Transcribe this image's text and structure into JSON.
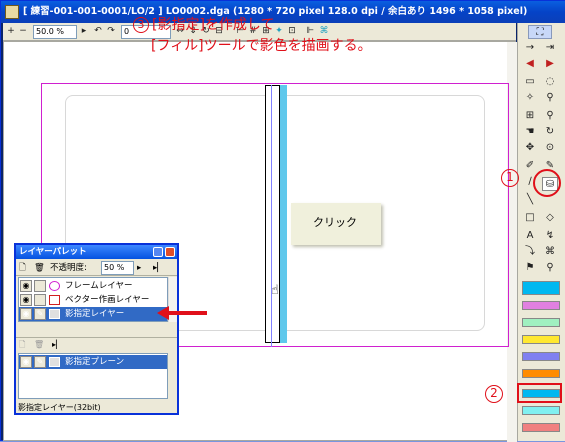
{
  "window": {
    "title": "[ 練習-001-001-0001/LO/2 ] LO0002.dga (1280 * 720 pixel 128.0 dpi / 余白あり 1496 * 1058 pixel)"
  },
  "toolbar": {
    "zoom_value": "50.0 %",
    "angle_value": "0"
  },
  "annotations": {
    "step3_number": "3",
    "step3_line1": "[影指定]を作成して",
    "step3_line2": "[フィル]ツールで影色を描画する。",
    "callout_text": "クリック",
    "step1_number": "1",
    "step2_number": "2"
  },
  "layer_palette": {
    "title": "レイヤーパレット",
    "opacity_label": "不透明度:",
    "opacity_value": "50 %",
    "layers": [
      {
        "name": "フレームレイヤー",
        "selected": false
      },
      {
        "name": "ベクター作画レイヤー",
        "selected": false
      },
      {
        "name": "影指定レイヤー",
        "selected": true
      }
    ],
    "planes": [
      {
        "name": "影指定プレーン",
        "selected": true
      }
    ],
    "status": "影指定レイヤー(32bit)"
  },
  "tool_palette": {
    "colors": [
      "#00b8f0",
      "#e080e0",
      "#a0f0c0",
      "#ffe830",
      "#8080f0",
      "#ff8c00",
      "#00b8f0",
      "#80f0f0",
      "#f08080"
    ]
  }
}
